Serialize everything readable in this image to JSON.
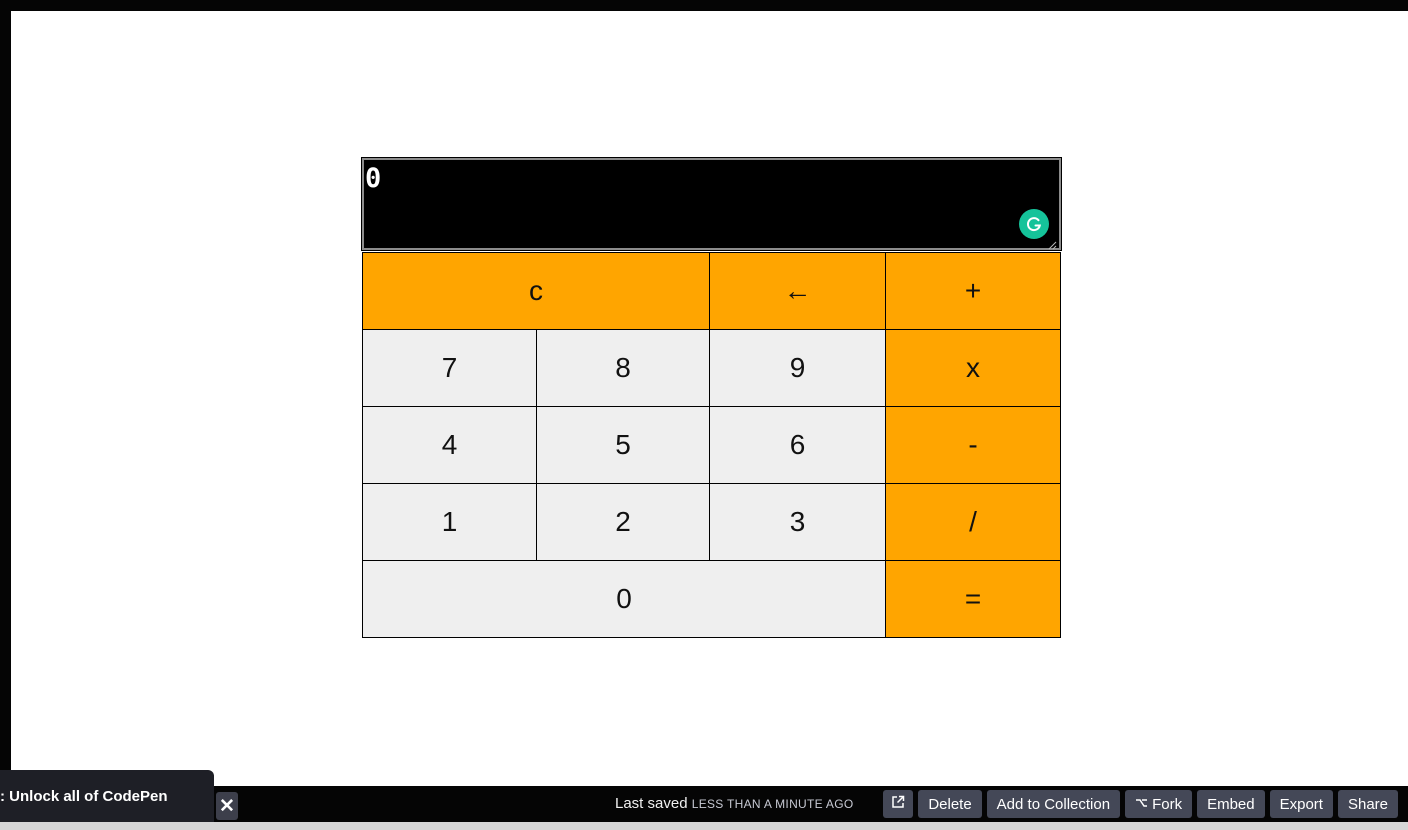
{
  "calculator": {
    "display_value": "0",
    "keys": {
      "clear": "c",
      "backspace": "←",
      "add": "+",
      "seven": "7",
      "eight": "8",
      "nine": "9",
      "multiply": "x",
      "four": "4",
      "five": "5",
      "six": "6",
      "subtract": "-",
      "one": "1",
      "two": "2",
      "three": "3",
      "divide": "/",
      "zero": "0",
      "equals": "="
    },
    "colors": {
      "operator": "#ffa500",
      "number": "#efefef",
      "display": "#000000"
    },
    "display_badge_icon": "grammarly-icon"
  },
  "footer": {
    "promo_text": ": Unlock all of CodePen",
    "promo_close": "✕",
    "last_saved_label": "Last saved",
    "last_saved_time": "less than a minute ago",
    "buttons": {
      "open_external_icon": "external-link-icon",
      "delete": "Delete",
      "add_to_collection": "Add to Collection",
      "fork": "Fork",
      "embed": "Embed",
      "export": "Export",
      "share": "Share"
    }
  }
}
